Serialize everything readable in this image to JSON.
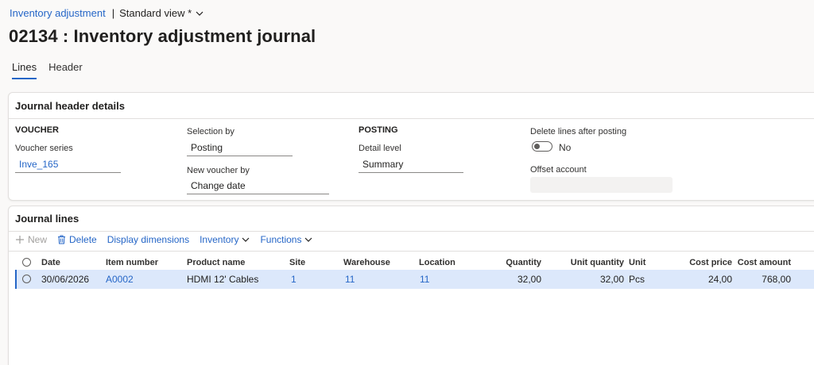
{
  "breadcrumb": {
    "module": "Inventory adjustment",
    "separator": "|",
    "view": "Standard view *"
  },
  "page_title": "02134 : Inventory adjustment journal",
  "tabs": [
    {
      "label": "Lines",
      "active": true
    },
    {
      "label": "Header",
      "active": false
    }
  ],
  "header_card": {
    "title": "Journal header details",
    "voucher_group": "VOUCHER",
    "voucher_series_label": "Voucher series",
    "voucher_series_value": "Inve_165",
    "selection_by_label": "Selection by",
    "selection_by_value": "Posting",
    "new_voucher_by_label": "New voucher by",
    "new_voucher_by_value": "Change date",
    "posting_group": "POSTING",
    "detail_level_label": "Detail level",
    "detail_level_value": "Summary",
    "delete_lines_label": "Delete lines after posting",
    "delete_lines_value": "No",
    "offset_account_label": "Offset account",
    "offset_account_value": ""
  },
  "lines_card": {
    "title": "Journal lines",
    "toolbar": {
      "new_label": "New",
      "delete_label": "Delete",
      "display_dimensions_label": "Display dimensions",
      "inventory_label": "Inventory",
      "functions_label": "Functions"
    },
    "columns": {
      "date": "Date",
      "item_number": "Item number",
      "product_name": "Product name",
      "site": "Site",
      "warehouse": "Warehouse",
      "location": "Location",
      "quantity": "Quantity",
      "unit_quantity": "Unit quantity",
      "unit": "Unit",
      "cost_price": "Cost price",
      "cost_amount": "Cost amount"
    },
    "rows": [
      {
        "date": "30/06/2026",
        "item_number": "A0002",
        "product_name": "HDMI 12' Cables",
        "site": "1",
        "warehouse": "11",
        "location": "11",
        "quantity": "32,00",
        "unit_quantity": "32,00",
        "unit": "Pcs",
        "cost_price": "24,00",
        "cost_amount": "768,00"
      }
    ]
  },
  "colors": {
    "accent": "#2566c7",
    "selected_row": "#dce8fb",
    "page_bg": "#faf9f8"
  }
}
